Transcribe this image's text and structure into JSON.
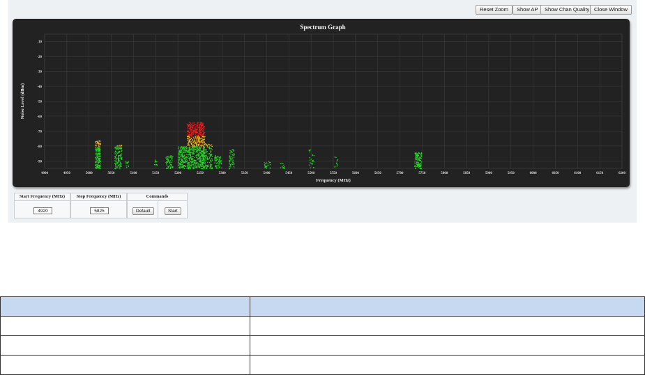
{
  "toolbar": {
    "reset_zoom": "Reset Zoom",
    "show_ap": "Show AP",
    "show_chan_quality": "Show Chan Quality",
    "close_window": "Close Window"
  },
  "chart_data": {
    "type": "scatter",
    "title": "Spectrum Graph",
    "xlabel": "Frequency (MHz)",
    "ylabel": "Noise Level (dBm)",
    "xlim": [
      4900,
      6200
    ],
    "ylim": [
      -95,
      -5
    ],
    "x_ticks": [
      "4900",
      "4950",
      "5000",
      "5050",
      "5100",
      "5150",
      "5200",
      "5250",
      "5300",
      "5350",
      "5400",
      "5450",
      "5500",
      "5550",
      "5600",
      "5650",
      "5700",
      "5750",
      "5800",
      "5850",
      "5900",
      "5950",
      "6000",
      "6050",
      "6100",
      "6150",
      "6200"
    ],
    "x_tick_labels_shown": [
      "4900",
      "4950",
      "5000",
      "5050",
      "5100",
      "5150",
      "5200",
      "5250",
      "5300",
      "5350",
      "5400",
      "5450",
      "5500",
      "5550",
      "5600",
      "5650",
      "5700",
      "5750",
      "5800",
      "5850",
      "5900",
      "5950",
      "6000",
      "6050",
      "6100",
      "6150",
      "6200"
    ],
    "y_ticks": [
      "-10",
      "-20",
      "-30",
      "-40",
      "-50",
      "-60",
      "-70",
      "-80",
      "-90"
    ],
    "grid": true,
    "color_scale": {
      "high": "#ff1a1a",
      "mid": "#e6d21a",
      "low": "#22dd22"
    },
    "series": [
      {
        "center": 5019,
        "width": 6,
        "top": -76,
        "density": 170
      },
      {
        "center": 5065,
        "width": 8,
        "top": -79,
        "density": 120
      },
      {
        "center": 5085,
        "width": 3,
        "top": -90,
        "density": 12
      },
      {
        "center": 5150,
        "width": 4,
        "top": -89,
        "density": 10
      },
      {
        "center": 5180,
        "width": 8,
        "top": -86,
        "density": 60
      },
      {
        "center": 5210,
        "width": 10,
        "top": -80,
        "density": 170
      },
      {
        "center": 5240,
        "width": 20,
        "top": -64,
        "density": 700
      },
      {
        "center": 5265,
        "width": 12,
        "top": -78,
        "density": 140
      },
      {
        "center": 5290,
        "width": 8,
        "top": -86,
        "density": 60
      },
      {
        "center": 5320,
        "width": 6,
        "top": -82,
        "density": 55
      },
      {
        "center": 5400,
        "width": 8,
        "top": -90,
        "density": 22
      },
      {
        "center": 5435,
        "width": 5,
        "top": -91,
        "density": 12
      },
      {
        "center": 5500,
        "width": 6,
        "top": -82,
        "density": 22
      },
      {
        "center": 5555,
        "width": 4,
        "top": -87,
        "density": 10
      },
      {
        "center": 5740,
        "width": 8,
        "top": -84,
        "density": 110
      }
    ]
  },
  "controls": {
    "start_header": "Start Frequency (MHz)",
    "stop_header": "Stop Frequency (MHz)",
    "commands_header": "Commands",
    "start_value": "4920",
    "stop_value": "5825",
    "default_label": "Default",
    "start_label": "Start"
  },
  "doc_table": {
    "rows": 4,
    "header_color": "#c6d9f1"
  }
}
